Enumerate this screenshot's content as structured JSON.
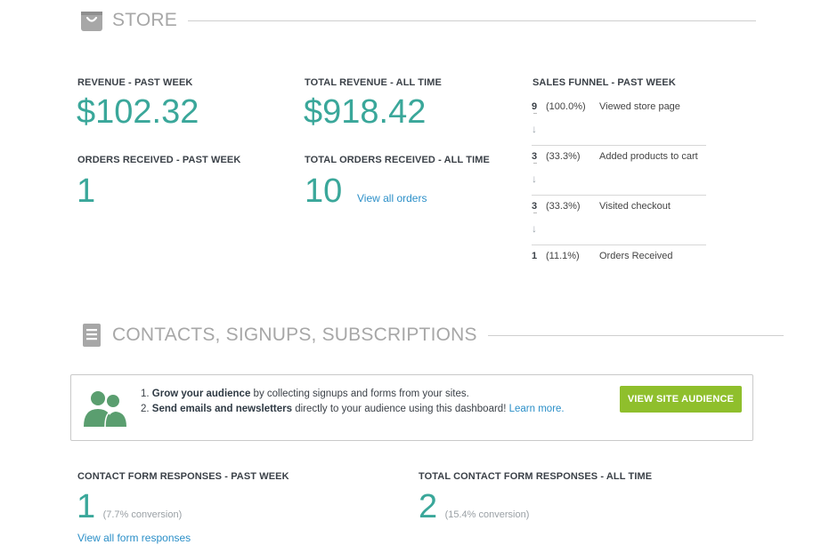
{
  "store": {
    "title": "STORE",
    "icon": "shopping-bag-icon"
  },
  "revenue_week": {
    "label": "REVENUE - PAST WEEK",
    "value": "$102.32"
  },
  "revenue_all": {
    "label": "TOTAL REVENUE - ALL TIME",
    "value": "$918.42"
  },
  "orders_week": {
    "label": "ORDERS RECEIVED - PAST WEEK",
    "value": "1"
  },
  "orders_all": {
    "label": "TOTAL ORDERS RECEIVED - ALL TIME",
    "value": "10",
    "link": "View all orders"
  },
  "funnel": {
    "label": "SALES FUNNEL - PAST WEEK",
    "steps": [
      {
        "count": "9",
        "pct": "(100.0%)",
        "label": "Viewed store page"
      },
      {
        "count": "3",
        "pct": "(33.3%)",
        "label": "Added products to cart"
      },
      {
        "count": "3",
        "pct": "(33.3%)",
        "label": "Visited checkout"
      },
      {
        "count": "1",
        "pct": "(11.1%)",
        "label": "Orders Received"
      }
    ],
    "arrow": "↓"
  },
  "contacts": {
    "title": "CONTACTS, SIGNUPS, SUBSCRIPTIONS",
    "icon": "document-icon"
  },
  "audience": {
    "line1_num": "1.",
    "line1_bold": "Grow your audience",
    "line1_rest": " by collecting signups and forms from your sites.",
    "line2_num": "2.",
    "line2_bold": "Send emails and newsletters",
    "line2_rest": " directly to your audience using this dashboard!",
    "learn_more": "Learn more.",
    "button": "VIEW SITE AUDIENCE"
  },
  "responses_week": {
    "label": "CONTACT FORM RESPONSES - PAST WEEK",
    "value": "1",
    "conversion": "(7.7% conversion)",
    "link": "View all form responses"
  },
  "responses_all": {
    "label": "TOTAL CONTACT FORM RESPONSES - ALL TIME",
    "value": "2",
    "conversion": "(15.4% conversion)"
  },
  "colors": {
    "accent": "#3aa79a",
    "link": "#2b8fc8",
    "button": "#8fbf2c",
    "icon_green": "#5a9e6f",
    "header_gray": "#a7a7a7"
  }
}
